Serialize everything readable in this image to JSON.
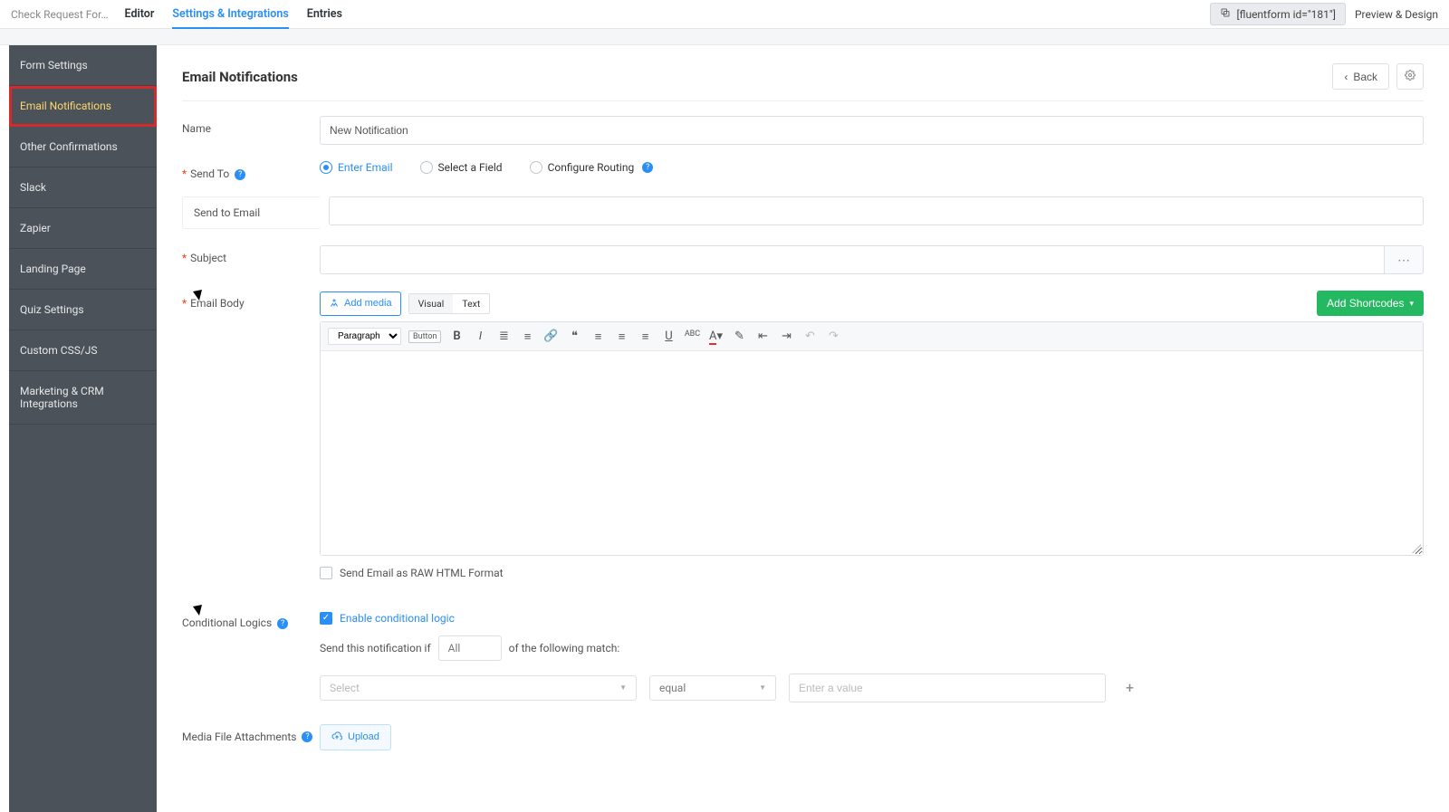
{
  "top": {
    "form_name": "Check Request For…",
    "tabs": {
      "editor": "Editor",
      "settings": "Settings & Integrations",
      "entries": "Entries"
    },
    "shortcode": "[fluentform id=\"181\"]",
    "preview": "Preview & Design"
  },
  "sidebar": {
    "items": [
      "Form Settings",
      "Email Notifications",
      "Other Confirmations",
      "Slack",
      "Zapier",
      "Landing Page",
      "Quiz Settings",
      "Custom CSS/JS",
      "Marketing & CRM Integrations"
    ]
  },
  "page": {
    "title": "Email Notifications",
    "back": "Back"
  },
  "labels": {
    "name": "Name",
    "send_to": "Send To",
    "send_to_email": "Send to Email",
    "subject": "Subject",
    "email_body": "Email Body",
    "conditional_logics": "Conditional Logics",
    "media_attach": "Media File Attachments"
  },
  "fields": {
    "name_value": "New Notification",
    "send_to_opts": {
      "enter": "Enter Email",
      "select_field": "Select a Field",
      "routing": "Configure Routing"
    },
    "add_media": "Add media",
    "tab_visual": "Visual",
    "tab_text": "Text",
    "add_shortcodes": "Add Shortcodes",
    "paragraph": "Paragraph",
    "button_label": "Button",
    "raw_html": "Send Email as RAW HTML Format",
    "enable_conditional": "Enable conditional logic",
    "cond_prefix": "Send this notification if",
    "cond_all": "All",
    "cond_suffix": "of the following match:",
    "sel_placeholder": "Select",
    "equal": "equal",
    "value_placeholder": "Enter a value",
    "upload": "Upload"
  }
}
